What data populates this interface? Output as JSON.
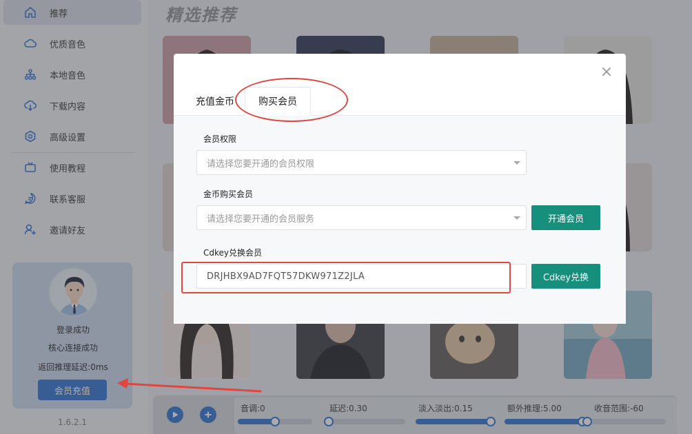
{
  "sidebar": {
    "items": [
      {
        "label": "推荐",
        "icon": "home-icon"
      },
      {
        "label": "优质音色",
        "icon": "cloud-icon"
      },
      {
        "label": "本地音色",
        "icon": "sitemap-icon"
      },
      {
        "label": "下载内容",
        "icon": "download-cloud-icon"
      },
      {
        "label": "高级设置",
        "icon": "settings-icon"
      },
      {
        "label": "使用教程",
        "icon": "tv-icon"
      },
      {
        "label": "联系客服",
        "icon": "chat-icon"
      },
      {
        "label": "邀请好友",
        "icon": "add-user-icon"
      }
    ],
    "user_card": {
      "status_login": "登录成功",
      "status_core": "核心连接成功",
      "latency": "返回推理延迟:0ms",
      "recharge_label": "会员充值"
    },
    "version": "1.6.2.1"
  },
  "main": {
    "title": "精选推荐"
  },
  "controls": {
    "sliders": [
      {
        "label": "音调:0",
        "value": 0.5
      },
      {
        "label": "延迟:0.30",
        "value": 0.03
      },
      {
        "label": "淡入淡出:0.15",
        "value": 0.96
      },
      {
        "label": "额外推理:5.00",
        "value": 0.99
      },
      {
        "label": "收音范围:-60",
        "value": 0.0
      }
    ]
  },
  "dialog": {
    "tabs": [
      {
        "label": "充值金币",
        "active": false
      },
      {
        "label": "购买会员",
        "active": true
      }
    ],
    "membership_rights_label": "会员权限",
    "membership_rights_placeholder": "请选择您要开通的会员权限",
    "coin_purchase_label": "金币购买会员",
    "coin_purchase_placeholder": "请选择您要开通的会员服务",
    "activate_label": "开通会员",
    "cdkey_label": "Cdkey兑换会员",
    "cdkey_value": "DRJHBX9AD7FQT57DKW971Z2JLA",
    "cdkey_button": "Cdkey兑换",
    "close_icon": "close-icon"
  },
  "colors": {
    "accent_blue": "#2b6fcf",
    "green_button": "#16907c",
    "annotation_red": "#e0463d"
  }
}
